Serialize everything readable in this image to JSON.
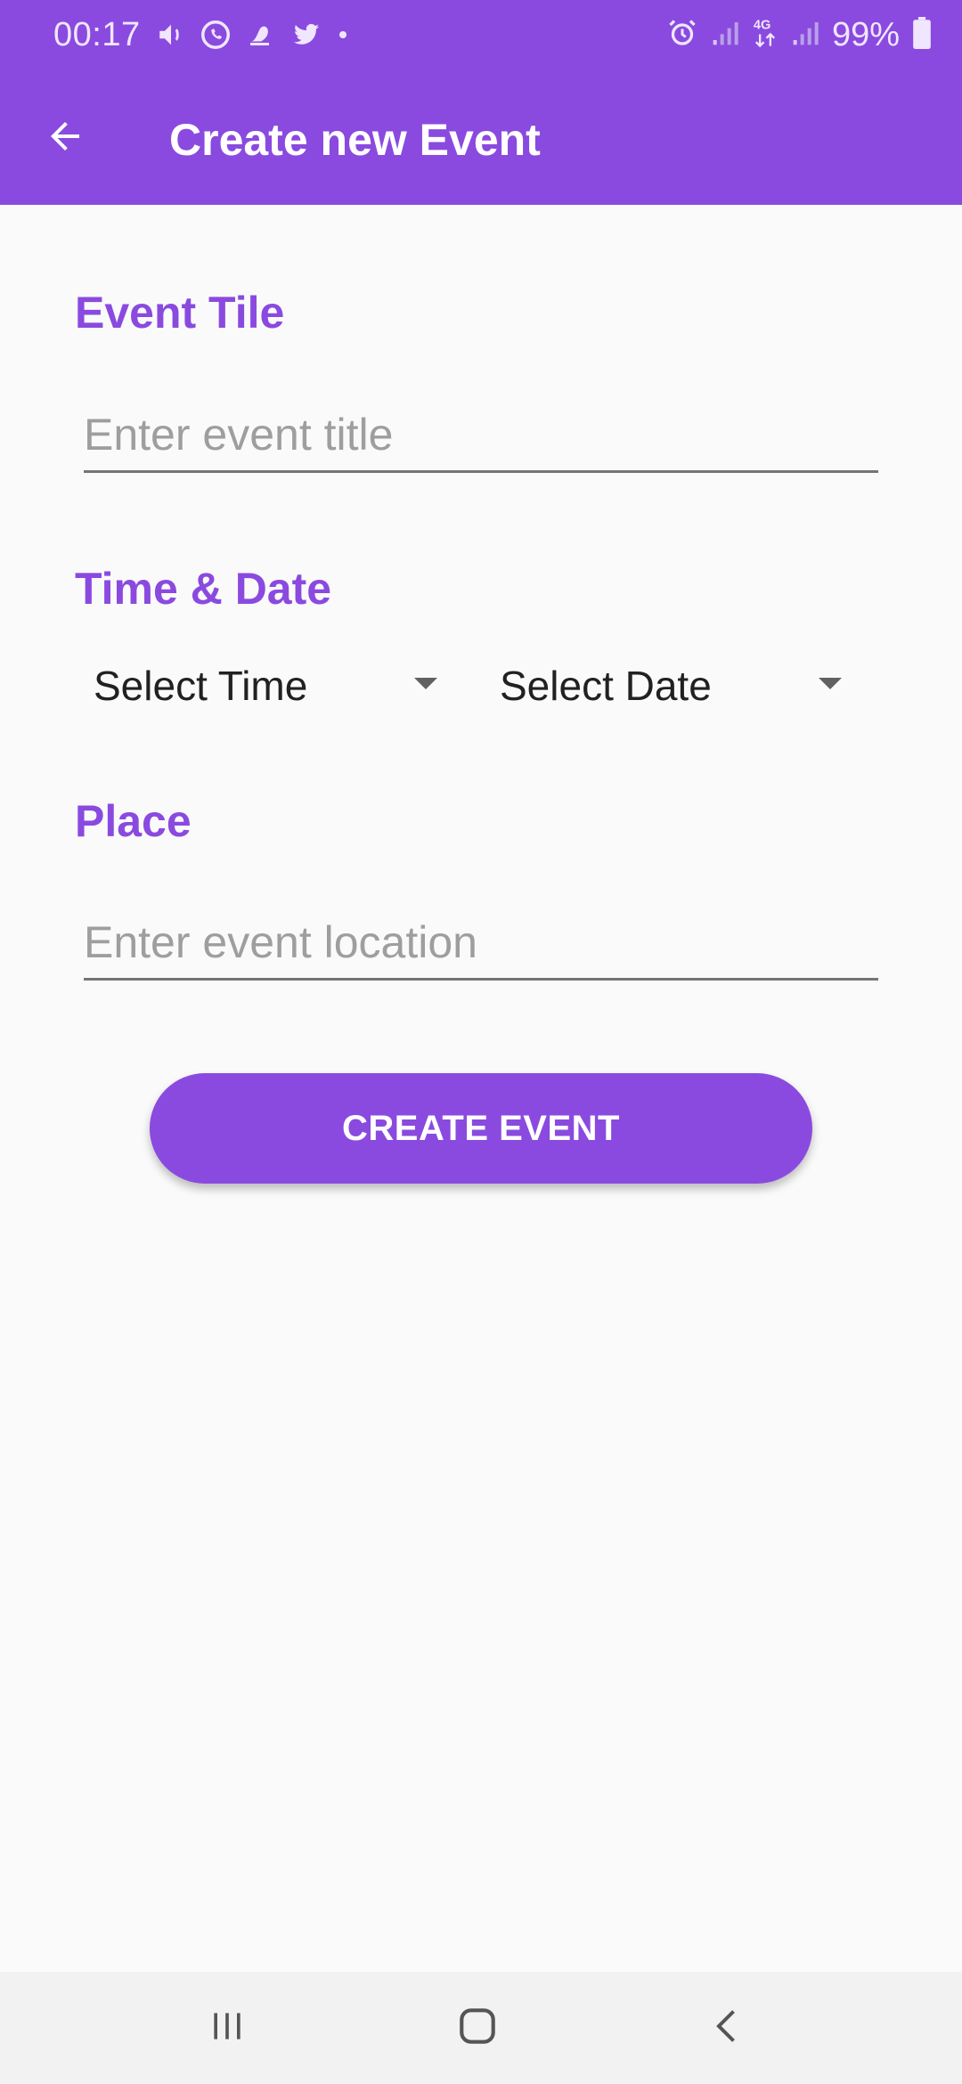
{
  "status_bar": {
    "time": "00:17",
    "battery": "99%",
    "network": "4G",
    "icons_left": [
      "volume-icon",
      "whatsapp-icon",
      "notification-bell-icon",
      "twitter-icon",
      "dot-icon"
    ],
    "icons_right": [
      "alarm-icon",
      "signal-icon",
      "network-4g-icon",
      "signal-icon",
      "battery-icon"
    ]
  },
  "app_bar": {
    "title": "Create new Event",
    "back_icon": "arrow-back-icon"
  },
  "form": {
    "title_label": "Event Tile",
    "title_placeholder": "Enter event title",
    "title_value": "",
    "time_date_label": "Time & Date",
    "time_select": "Select Time",
    "date_select": "Select Date",
    "place_label": "Place",
    "place_placeholder": "Enter event location",
    "place_value": "",
    "submit_label": "CREATE EVENT"
  },
  "nav_bar": {
    "recents_icon": "recents-icon",
    "home_icon": "home-icon",
    "back_icon": "back-chevron-icon"
  },
  "colors": {
    "primary": "#8a4adf",
    "background": "#fafafa",
    "text": "#212121",
    "hint": "#9e9e9e"
  }
}
